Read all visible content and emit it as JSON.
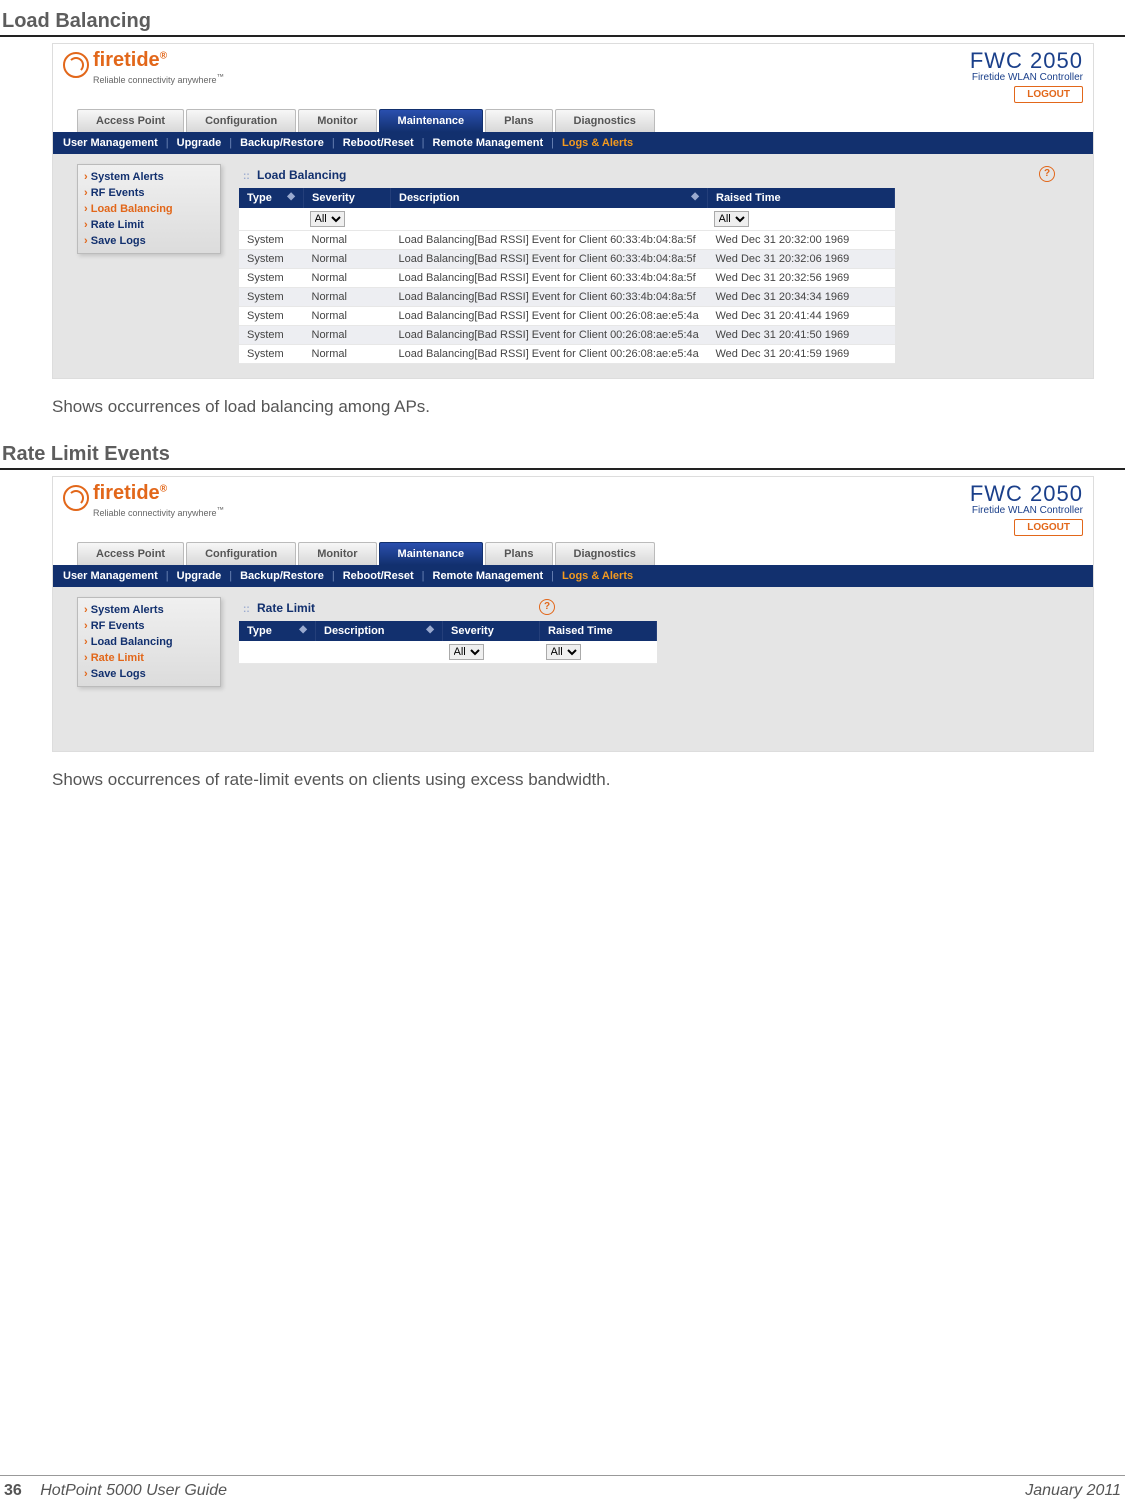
{
  "section1": {
    "title": "Load Balancing",
    "caption": "Shows occurrences of load balancing among APs."
  },
  "section2": {
    "title": "Rate Limit Events",
    "caption": "Shows occurrences of rate-limit events on clients using excess bandwidth."
  },
  "common": {
    "logo_text": "firetide",
    "logo_tagline": "Reliable connectivity anywhere",
    "brand_model": "FWC 2050",
    "brand_sub": "Firetide WLAN Controller",
    "logout": "LOGOUT",
    "main_tabs": [
      "Access Point",
      "Configuration",
      "Monitor",
      "Maintenance",
      "Plans",
      "Diagnostics"
    ],
    "active_main_tab": 3,
    "sub_nav": [
      "User Management",
      "Upgrade",
      "Backup/Restore",
      "Reboot/Reset",
      "Remote Management",
      "Logs & Alerts"
    ],
    "active_sub": 5,
    "help_glyph": "?"
  },
  "screenshot1": {
    "side_items": [
      "System Alerts",
      "RF Events",
      "Load Balancing",
      "Rate Limit",
      "Save Logs"
    ],
    "active_side": 2,
    "panel_title": "Load Balancing",
    "columns": [
      "Type",
      "Severity",
      "Description",
      "Raised Time"
    ],
    "filter_all": "All",
    "rows": [
      {
        "type": "System",
        "sev": "Normal",
        "desc": "Load Balancing[Bad RSSI] Event for Client 60:33:4b:04:8a:5f",
        "time": "Wed Dec 31 20:32:00 1969"
      },
      {
        "type": "System",
        "sev": "Normal",
        "desc": "Load Balancing[Bad RSSI] Event for Client 60:33:4b:04:8a:5f",
        "time": "Wed Dec 31 20:32:06 1969"
      },
      {
        "type": "System",
        "sev": "Normal",
        "desc": "Load Balancing[Bad RSSI] Event for Client 60:33:4b:04:8a:5f",
        "time": "Wed Dec 31 20:32:56 1969"
      },
      {
        "type": "System",
        "sev": "Normal",
        "desc": "Load Balancing[Bad RSSI] Event for Client 60:33:4b:04:8a:5f",
        "time": "Wed Dec 31 20:34:34 1969"
      },
      {
        "type": "System",
        "sev": "Normal",
        "desc": "Load Balancing[Bad RSSI] Event for Client 00:26:08:ae:e5:4a",
        "time": "Wed Dec 31 20:41:44 1969"
      },
      {
        "type": "System",
        "sev": "Normal",
        "desc": "Load Balancing[Bad RSSI] Event for Client 00:26:08:ae:e5:4a",
        "time": "Wed Dec 31 20:41:50 1969"
      },
      {
        "type": "System",
        "sev": "Normal",
        "desc": "Load Balancing[Bad RSSI] Event for Client 00:26:08:ae:e5:4a",
        "time": "Wed Dec 31 20:41:59 1969"
      }
    ]
  },
  "screenshot2": {
    "side_items": [
      "System Alerts",
      "RF Events",
      "Load Balancing",
      "Rate Limit",
      "Save Logs"
    ],
    "active_side": 3,
    "panel_title": "Rate Limit",
    "columns": [
      "Type",
      "Description",
      "Severity",
      "Raised Time"
    ],
    "filter_all": "All"
  },
  "footer": {
    "page_num": "36",
    "guide": "HotPoint 5000 User Guide",
    "date": "January 2011"
  }
}
